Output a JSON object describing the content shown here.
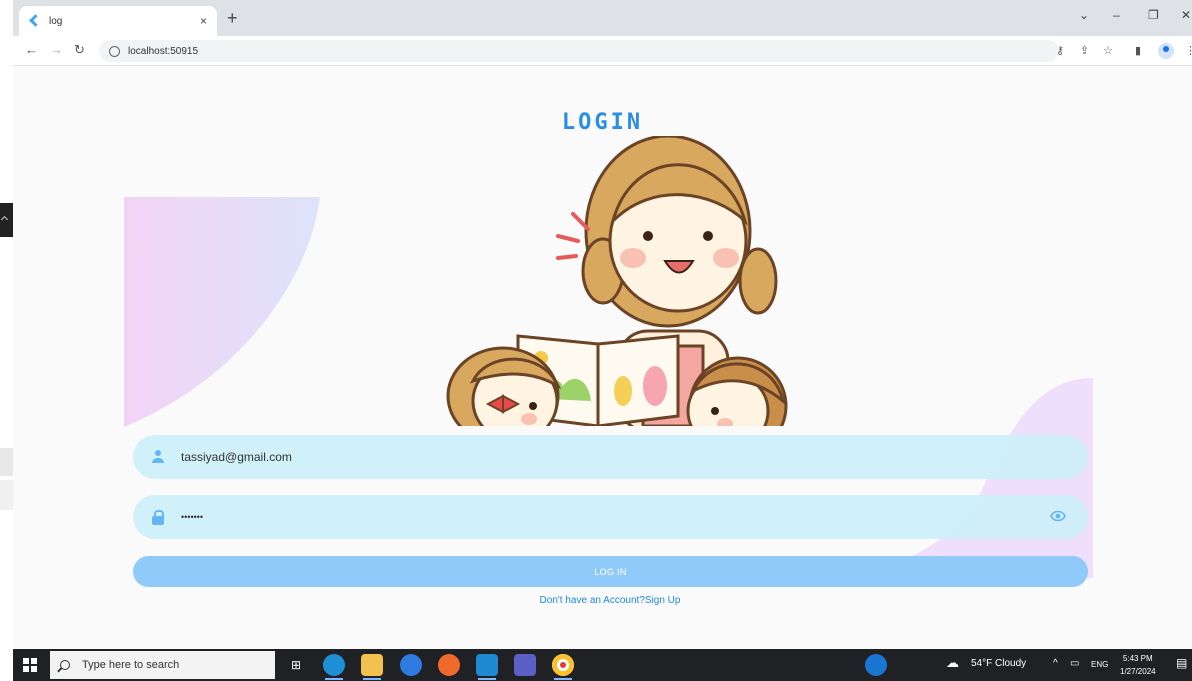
{
  "browser": {
    "tab_title": "log",
    "tab_close": "×",
    "new_tab": "+",
    "url": "localhost:50915",
    "window_controls": {
      "dropdown": "⌄",
      "minimize": "–",
      "restore": "❐",
      "close": "✕"
    }
  },
  "page": {
    "title": "LOGIN",
    "email_value": "tassiyad@gmail.com",
    "password_value": "•••••••",
    "login_button": "LOG IN",
    "signup_link": "Don't have an Account?Sign Up"
  },
  "colors": {
    "accent": "#2b8fe0",
    "field_bg": "#cdf0fa",
    "button_bg": "#90caf9",
    "link": "#1e88e5"
  },
  "taskbar": {
    "search_placeholder": "Type here to search",
    "weather": "54°F Cloudy",
    "language": "ENG",
    "time": "5:43 PM",
    "date": "1/27/2024"
  }
}
